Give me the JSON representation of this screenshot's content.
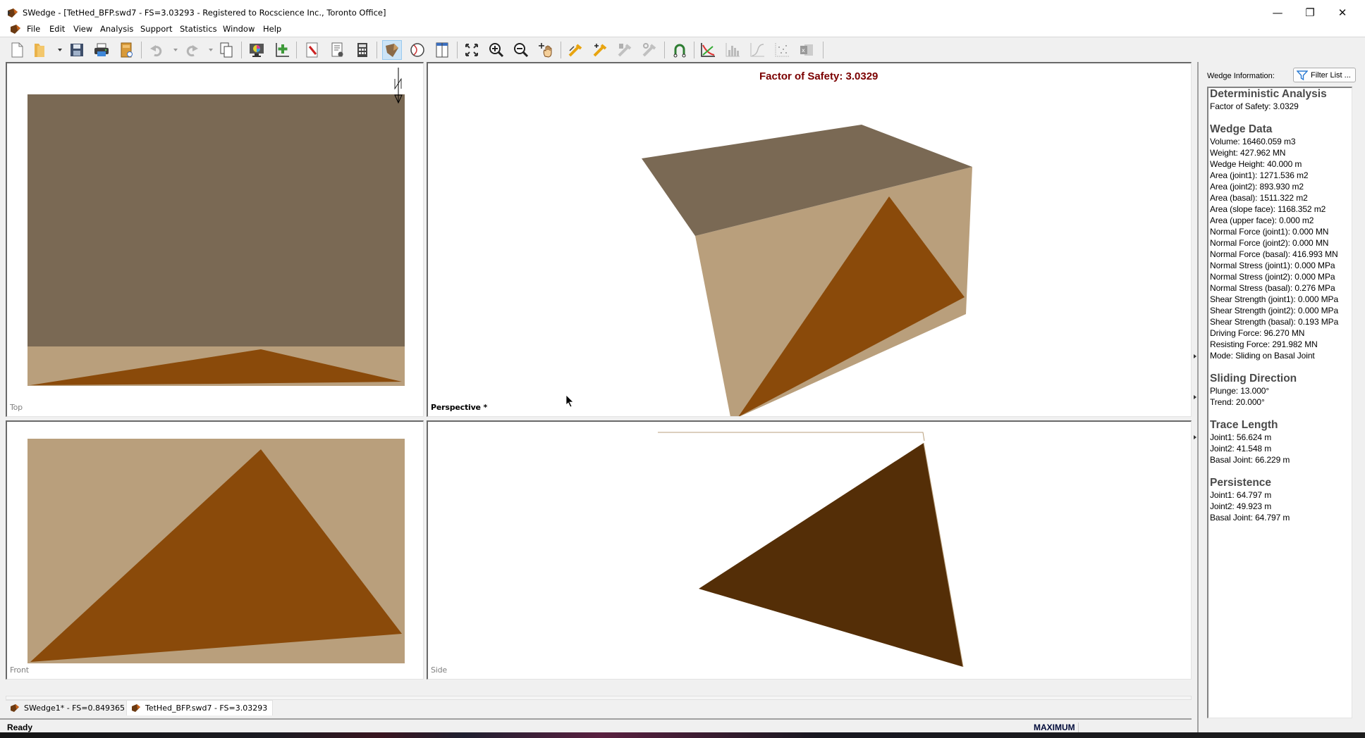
{
  "window": {
    "title": "SWedge - [TetHed_BFP.swd7 - FS=3.03293 - Registered to Rocscience Inc., Toronto Office]",
    "controls": {
      "minimize": "—",
      "restore": "❐",
      "close": "✕"
    },
    "mdi_controls": {
      "minimize": "_",
      "restore": "🗗",
      "close": "✕"
    }
  },
  "menu": {
    "items": [
      "File",
      "Edit",
      "View",
      "Analysis",
      "Support",
      "Statistics",
      "Window",
      "Help"
    ]
  },
  "toolbar": {
    "buttons": [
      {
        "name": "new-file-icon"
      },
      {
        "name": "open-folder-icon",
        "dropdown": true
      },
      {
        "name": "save-icon"
      },
      {
        "name": "print-icon"
      },
      {
        "name": "document-properties-icon"
      },
      {
        "name": "undo-icon",
        "dropdown": true,
        "disabled": true
      },
      {
        "name": "redo-icon",
        "dropdown": true,
        "disabled": true
      },
      {
        "name": "copy-icon"
      },
      {
        "name": "display-options-icon"
      },
      {
        "name": "add-chart-axis-icon"
      },
      {
        "name": "edit-input-icon"
      },
      {
        "name": "project-settings-icon"
      },
      {
        "name": "compute-icon"
      },
      {
        "name": "wedge-3d-view-icon",
        "active": true
      },
      {
        "name": "stereonet-view-icon"
      },
      {
        "name": "four-view-icon"
      },
      {
        "name": "zoom-all-icon"
      },
      {
        "name": "zoom-in-icon"
      },
      {
        "name": "zoom-out-icon"
      },
      {
        "name": "pan-icon"
      },
      {
        "name": "edit-bolt-icon"
      },
      {
        "name": "add-bolt-icon"
      },
      {
        "name": "delete-bolt-icon",
        "disabled": true
      },
      {
        "name": "bolt-properties-icon",
        "disabled": true
      },
      {
        "name": "magnet-icon"
      },
      {
        "name": "sensitivity-plot-icon"
      },
      {
        "name": "histogram-icon",
        "disabled": true
      },
      {
        "name": "cumulative-plot-icon",
        "disabled": true
      },
      {
        "name": "scatter-plot-icon",
        "disabled": true
      },
      {
        "name": "export-excel-icon",
        "disabled": true
      }
    ]
  },
  "views": {
    "top": {
      "label": "Top",
      "north_label": "N"
    },
    "perspective": {
      "label": "Perspective *",
      "fos_title": "Factor of Safety: 3.0329"
    },
    "front": {
      "label": "Front"
    },
    "side": {
      "label": "Side"
    }
  },
  "colors": {
    "upper_face": "#7a6954",
    "slope_face": "#b99f7c",
    "wedge_face": "#8a4a0a",
    "wedge_side": "#542e07",
    "fos_title": "#7b0000"
  },
  "wedge_info": {
    "label": "Wedge Information:",
    "filter_button": "Filter List ...",
    "sections": [
      {
        "heading": "Deterministic Analysis",
        "lines": [
          "Factor of Safety: 3.0329"
        ]
      },
      {
        "heading": "Wedge Data",
        "lines": [
          "Volume: 16460.059 m3",
          "Weight: 427.962 MN",
          "Wedge Height: 40.000 m",
          "Area (joint1): 1271.536 m2",
          "Area (joint2): 893.930 m2",
          "Area (basal): 1511.322 m2",
          "Area (slope face): 1168.352 m2",
          "Area (upper face): 0.000 m2",
          "Normal Force (joint1): 0.000 MN",
          "Normal Force (joint2): 0.000 MN",
          "Normal Force (basal): 416.993 MN",
          "Normal Stress (joint1): 0.000 MPa",
          "Normal Stress (joint2): 0.000 MPa",
          "Normal Stress (basal): 0.276 MPa",
          "Shear Strength (joint1): 0.000 MPa",
          "Shear Strength (joint2): 0.000 MPa",
          "Shear Strength (basal): 0.193 MPa",
          "Driving Force: 96.270 MN",
          "Resisting Force: 291.982 MN",
          "Mode: Sliding on Basal Joint"
        ]
      },
      {
        "heading": "Sliding Direction",
        "lines": [
          "Plunge: 13.000°",
          "Trend: 20.000°"
        ]
      },
      {
        "heading": "Trace Length",
        "lines": [
          "Joint1: 56.624 m",
          "Joint2: 41.548 m",
          "Basal Joint: 66.229 m"
        ]
      },
      {
        "heading": "Persistence",
        "lines": [
          "Joint1: 64.797 m",
          "Joint2: 49.923 m",
          "Basal Joint: 64.797 m"
        ]
      }
    ]
  },
  "document_tabs": [
    {
      "label": "SWedge1* - FS=0.849365",
      "selected": false
    },
    {
      "label": "TetHed_BFP.swd7 - FS=3.03293",
      "selected": true
    }
  ],
  "status": {
    "text": "Ready",
    "mode": "MAXIMUM"
  }
}
